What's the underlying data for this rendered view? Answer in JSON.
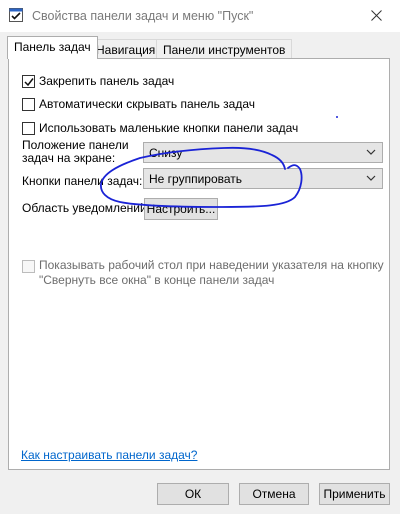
{
  "window": {
    "title": "Свойства панели задач и меню \"Пуск\"",
    "icons": {
      "app": "checklist-icon",
      "close": "close-icon"
    }
  },
  "tabs": [
    {
      "label": "Панель задач",
      "active": true
    },
    {
      "label": "Навигация",
      "active": false
    },
    {
      "label": "Панели инструментов",
      "active": false
    }
  ],
  "taskbar": {
    "lock": {
      "label": "Закрепить панель задач",
      "checked": true
    },
    "autohide": {
      "label": "Автоматически скрывать панель задач",
      "checked": false
    },
    "small_buttons": {
      "label": "Использовать маленькие кнопки панели задач",
      "checked": false
    },
    "position": {
      "label_line1": "Положение панели",
      "label_line2": "задач на экране:",
      "value": "Снизу"
    },
    "buttons": {
      "label": "Кнопки панели задач:",
      "value": "Не группировать"
    },
    "notifications": {
      "label": "Область уведомлений:",
      "button": "Настроить..."
    },
    "peek": {
      "line1": "Показывать рабочий стол при наведении указателя на кнопку",
      "line2": "\"Свернуть все окна\" в конце панели задач",
      "checked": false,
      "enabled": false
    },
    "help_link": "Как настраивать панели задач?"
  },
  "footer": {
    "ok": "ОК",
    "cancel": "Отмена",
    "apply": "Применить"
  },
  "colors": {
    "annotation": "#1a23d6",
    "link": "#0066cc"
  }
}
